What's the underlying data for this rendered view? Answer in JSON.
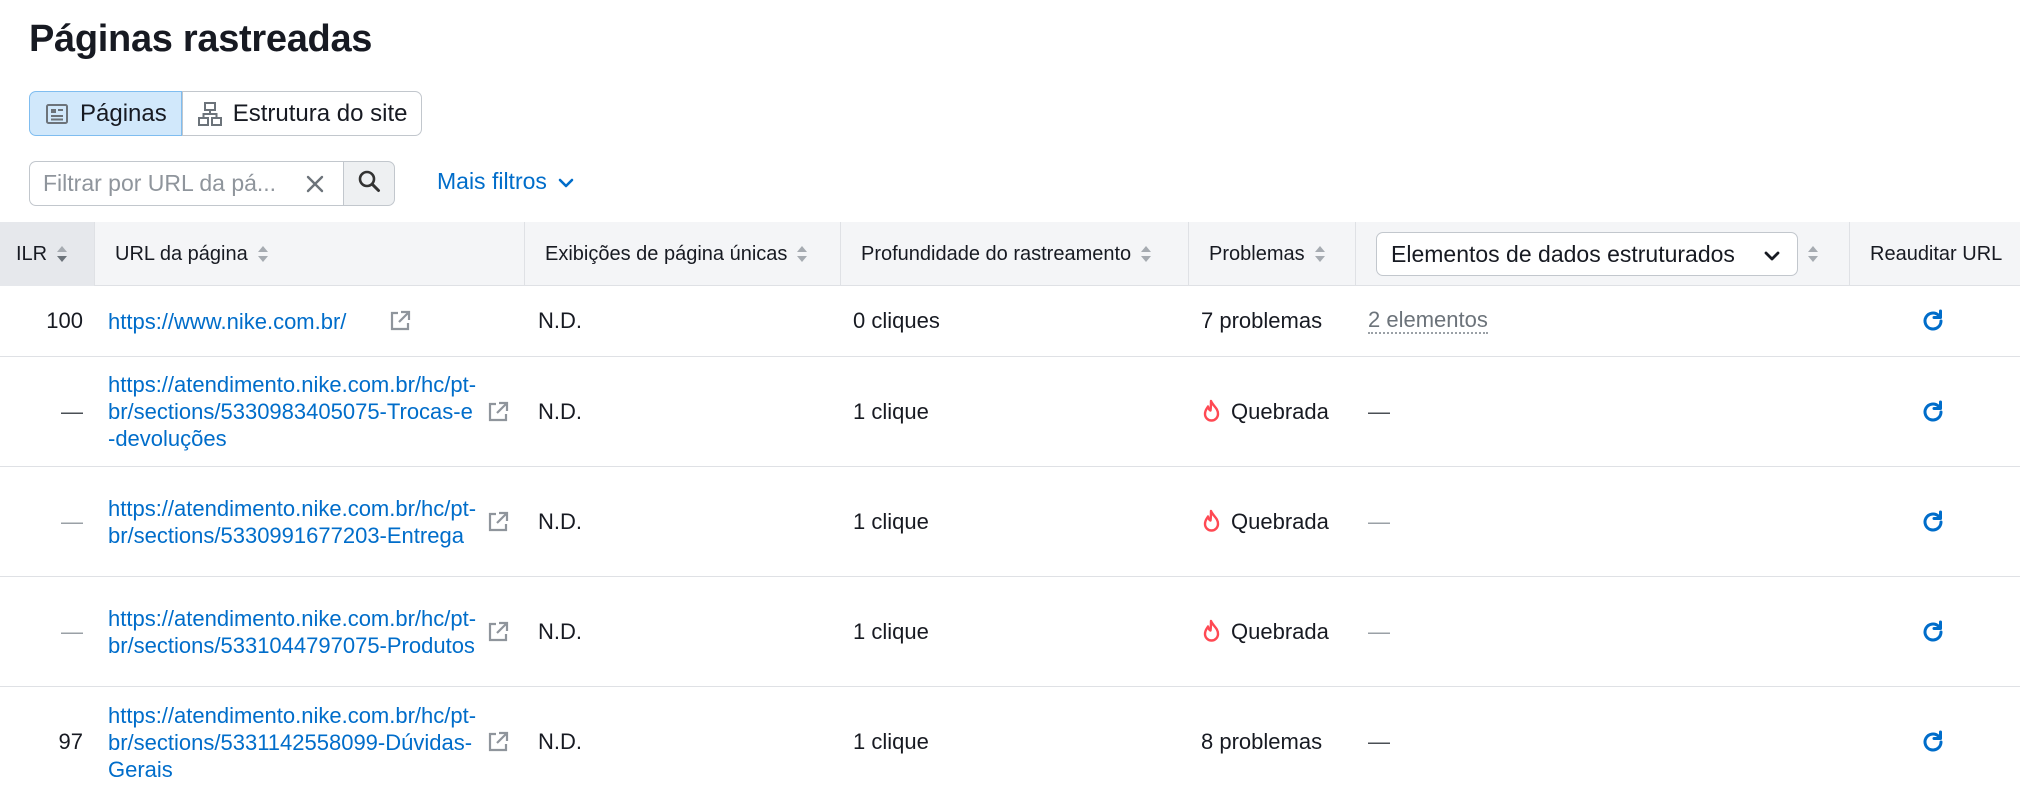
{
  "page": {
    "title": "Páginas rastreadas"
  },
  "view_switcher": {
    "pages_label": "Páginas",
    "structure_label": "Estrutura do site",
    "active": "pages"
  },
  "filter": {
    "placeholder": "Filtrar por URL da pá...",
    "value": "",
    "more_filters_label": "Mais filtros"
  },
  "table": {
    "columns": {
      "ilr": "ILR",
      "url": "URL da página",
      "views": "Exibições de página únicas",
      "depth": "Profundidade do rastreamento",
      "problems": "Problemas",
      "structured_select": "Elementos de dados estruturados",
      "reaudit": "Reauditar URL"
    },
    "rows": [
      {
        "ilr": "100",
        "url": "https://www.nike.com.br/",
        "views": "N.D.",
        "depth": "0 cliques",
        "problems": "7 problemas",
        "problem_type": "count",
        "structured": "2 elementos",
        "structured_type": "link"
      },
      {
        "ilr": "—",
        "url": "https://atendimento.nike.com.br/hc/pt-br/sections/5330983405075-Trocas-e-devoluções",
        "views": "N.D.",
        "depth": "1 clique",
        "problems": "Quebrada",
        "problem_type": "broken",
        "structured": "—",
        "structured_type": "dash"
      },
      {
        "ilr": "—",
        "url": "https://atendimento.nike.com.br/hc/pt-br/sections/5330991677203-Entrega",
        "views": "N.D.",
        "depth": "1 clique",
        "problems": "Quebrada",
        "problem_type": "broken",
        "structured": "—",
        "structured_type": "dash-light"
      },
      {
        "ilr": "—",
        "url": "https://atendimento.nike.com.br/hc/pt-br/sections/5331044797075-Produtos",
        "views": "N.D.",
        "depth": "1 clique",
        "problems": "Quebrada",
        "problem_type": "broken",
        "structured": "—",
        "structured_type": "dash-light"
      },
      {
        "ilr": "97",
        "url": "https://atendimento.nike.com.br/hc/pt-br/sections/5331142558099-Dúvidas-Gerais",
        "views": "N.D.",
        "depth": "1 clique",
        "problems": "8 problemas",
        "problem_type": "count",
        "structured": "—",
        "structured_type": "dash"
      }
    ]
  },
  "icons": {
    "pages": "pages-icon",
    "structure": "site-structure-icon",
    "clear": "close-icon",
    "search": "search-icon",
    "chevron": "chevron-down-icon",
    "external": "external-link-icon",
    "broken": "fire-icon",
    "reaudit": "refresh-icon"
  },
  "colors": {
    "link": "#006dca",
    "active_tab_bg": "#d1e8fb",
    "header_bg": "#f4f5f7",
    "broken_icon": "#ff4953"
  }
}
